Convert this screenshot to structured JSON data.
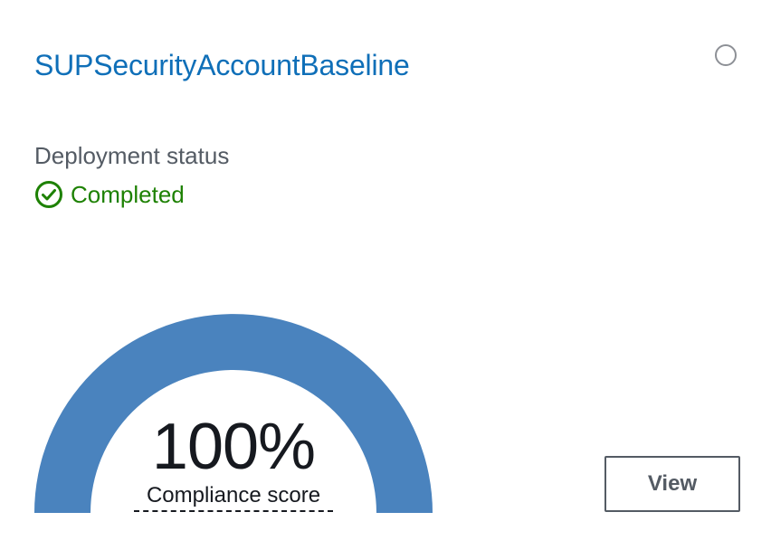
{
  "card": {
    "title": "SUPSecurityAccountBaseline",
    "deployment_status_label": "Deployment status",
    "deployment_status_value": "Completed",
    "status_icon": "check-circle-icon",
    "compliance": {
      "score_text": "100%",
      "score_fraction": 1.0,
      "label": "Compliance score"
    },
    "view_button_label": "View"
  },
  "colors": {
    "title_link": "#0f6fb8",
    "status_success": "#1d8102",
    "gauge_fill": "#4a83be",
    "muted_text": "#545b64"
  }
}
